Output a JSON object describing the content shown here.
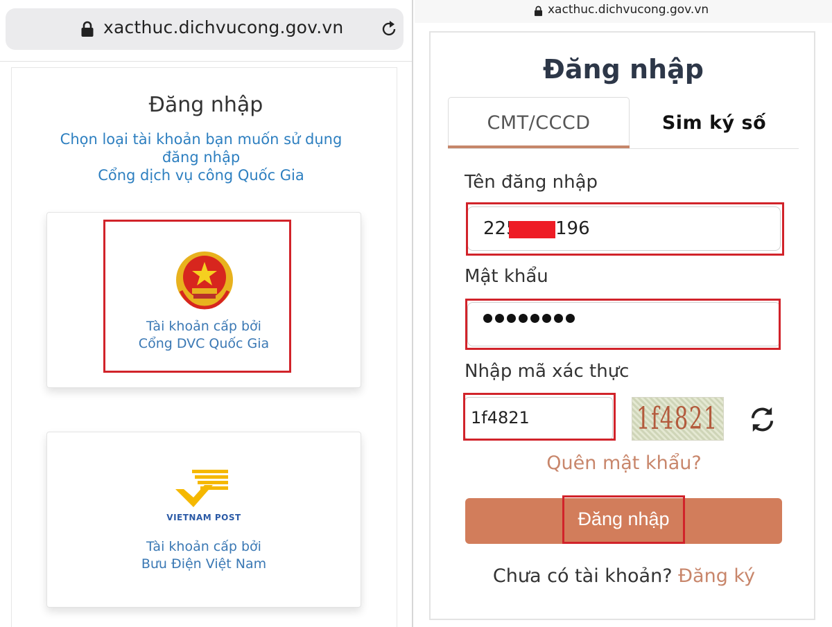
{
  "left": {
    "url": "xacthuc.dichvucong.gov.vn",
    "title": "Đăng nhập",
    "subtitle_lines": [
      "Chọn loại tài khoản bạn muốn sử dụng",
      "đăng nhập",
      "Cổng dịch vụ công Quốc Gia"
    ],
    "cards": [
      {
        "caption_lines": [
          "Tài khoản cấp bởi",
          "Cổng DVC Quốc Gia"
        ]
      },
      {
        "logo_text": "VIETNAM POST",
        "caption_lines": [
          "Tài khoản cấp bởi",
          "Bưu Điện Việt Nam"
        ]
      }
    ]
  },
  "right": {
    "url": "xacthuc.dichvucong.gov.vn",
    "title": "Đăng nhập",
    "tabs": [
      {
        "label": "CMT/CCCD",
        "active": true
      },
      {
        "label": "Sim ký số",
        "active": false
      }
    ],
    "username_label": "Tên đăng nhập",
    "username_prefix": "225",
    "username_suffix": "196",
    "password_label": "Mật khẩu",
    "password_dots": 8,
    "captcha_label": "Nhập mã xác thực",
    "captcha_value": "1f4821",
    "captcha_image_text": "1f4821",
    "forgot": "Quên mật khẩu?",
    "login_button": "Đăng nhập",
    "no_account": "Chưa có tài khoản?",
    "register": "Đăng ký"
  },
  "colors": {
    "link_blue": "#2d7fc0",
    "accent": "#d27d5b",
    "highlight_red": "#d1232a"
  },
  "icons": [
    "lock-icon",
    "reload-icon",
    "vietnam-emblem-icon",
    "vietnam-post-logo-icon",
    "refresh-captcha-icon"
  ]
}
